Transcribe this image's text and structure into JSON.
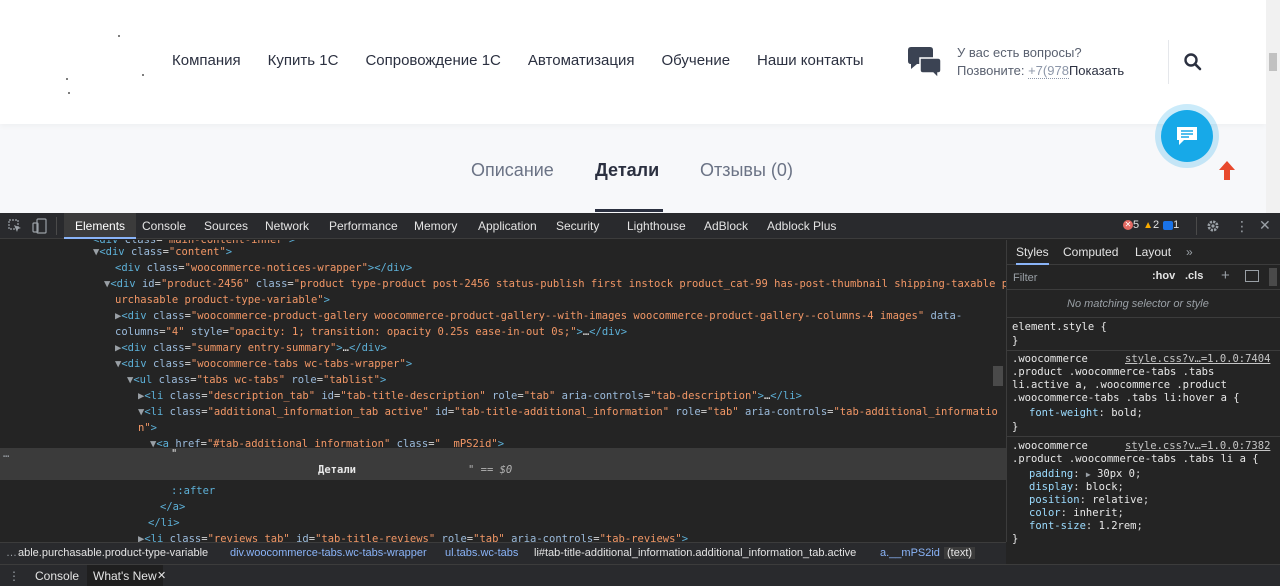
{
  "site": {
    "nav": [
      "Компания",
      "Купить 1С",
      "Сопровождение 1С",
      "Автоматизация",
      "Обучение",
      "Наши контакты"
    ],
    "contact": {
      "question": "У вас есть вопросы?",
      "call": "Позвоните: ",
      "phone": "+7(978",
      "show": "Показать"
    },
    "tabs": {
      "description": "Описание",
      "details": "Детали",
      "reviews": "Отзывы (0)"
    },
    "colors": {
      "accent": "#17a9e8",
      "arrow": "#e8492d",
      "nav_text": "#2b3040"
    }
  },
  "devtools": {
    "tabs": [
      "Elements",
      "Console",
      "Sources",
      "Network",
      "Performance",
      "Memory",
      "Application",
      "Security",
      "Lighthouse",
      "AdBlock",
      "Adblock Plus"
    ],
    "counts": {
      "errors": "5",
      "warnings": "2",
      "info": "1"
    },
    "dom_lines": [
      {
        "indent": "",
        "text": "<div class=\"main-content-inner\">"
      },
      {
        "tag": "div",
        "attrs": [
          [
            "class",
            "content"
          ]
        ]
      }
    ],
    "selected_text": "Детали",
    "selected_suffix": "\" == $0",
    "styles_tabs": [
      "Styles",
      "Computed",
      "Layout",
      "»"
    ],
    "filter_placeholder": "Filter",
    "hov": ":hov",
    "cls": ".cls",
    "no_match": "No matching selector or style",
    "element_style": "element.style {",
    "rule1": {
      "link": "style.css?v…=1.0.0:7404",
      "selector": [
        ".woocommerce",
        ".product .woocommerce-tabs .tabs",
        "li.active a, .woocommerce .product",
        ".woocommerce-tabs .tabs li:hover a {"
      ],
      "props": [
        [
          "font-weight",
          "bold"
        ]
      ]
    },
    "rule2": {
      "link": "style.css?v…=1.0.0:7382",
      "selector": [
        ".woocommerce",
        ".product .woocommerce-tabs .tabs li a {"
      ],
      "props": [
        [
          "padding",
          "30px 0"
        ],
        [
          "display",
          "block"
        ],
        [
          "position",
          "relative"
        ],
        [
          "color",
          "inherit"
        ],
        [
          "font-size",
          "1.2rem"
        ]
      ]
    },
    "breadcrumbs": [
      "able.purchasable.product-type-variable",
      "div.woocommerce-tabs.wc-tabs-wrapper",
      "ul.tabs.wc-tabs",
      "li#tab-title-additional_information.additional_information_tab.active",
      "a.__mPS2id",
      "(text)"
    ],
    "drawer_tabs": [
      "Console",
      "What's New"
    ]
  }
}
